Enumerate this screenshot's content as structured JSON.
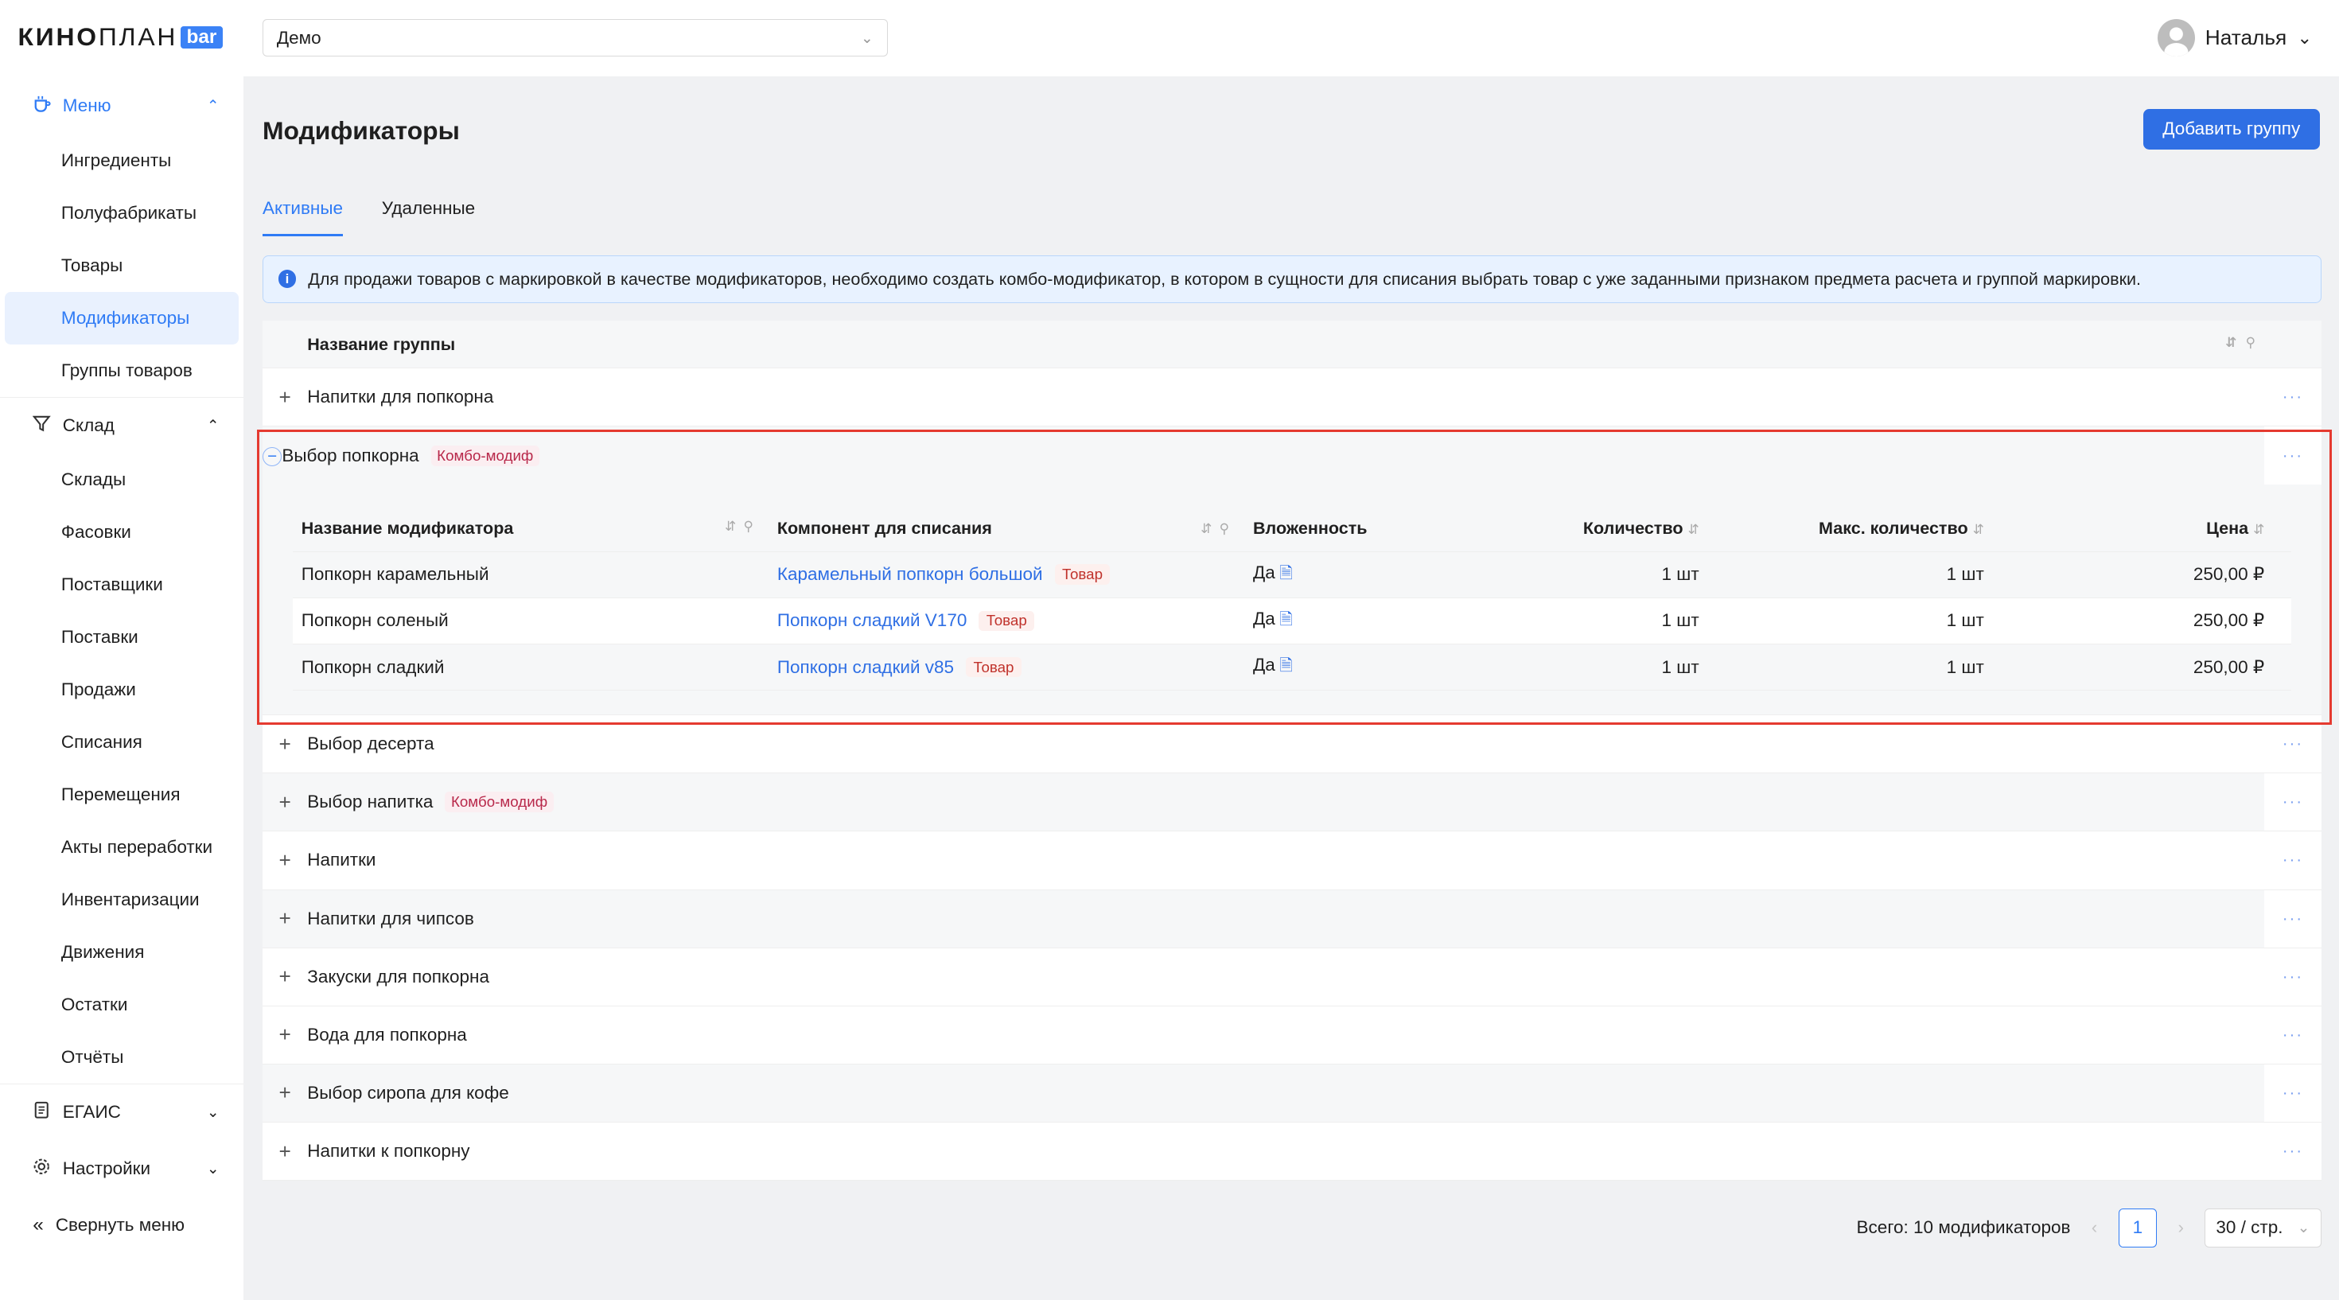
{
  "brand": {
    "part1": "КИНО",
    "part2": "ПЛАН",
    "badge": "bar"
  },
  "top": {
    "cinema_select": "Демо",
    "user_name": "Наталья"
  },
  "sidebar": {
    "menu_group": "Меню",
    "menu_items": [
      "Ингредиенты",
      "Полуфабрикаты",
      "Товары",
      "Модификаторы",
      "Группы товаров"
    ],
    "warehouse_group": "Склад",
    "warehouse_items": [
      "Склады",
      "Фасовки",
      "Поставщики",
      "Поставки",
      "Продажи",
      "Списания",
      "Перемещения",
      "Акты переработки",
      "Инвентаризации",
      "Движения",
      "Остатки",
      "Отчёты"
    ],
    "egais": "ЕГАИС",
    "settings": "Настройки",
    "collapse": "Свернуть меню"
  },
  "page": {
    "title": "Модификаторы",
    "add_button": "Добавить группу",
    "tabs": [
      "Активные",
      "Удаленные"
    ],
    "info": "Для продажи товаров с маркировкой в качестве модификаторов, необходимо создать комбо-модификатор, в котором в сущности для списания выбрать товар с уже заданными признаком предмета расчета и группой маркировки."
  },
  "table": {
    "header": "Название группы",
    "combo_badge": "Комбо-модиф",
    "more": "···",
    "groups_before": [
      {
        "name": "Напитки для попкорна",
        "combo": false
      }
    ],
    "expanded_group": {
      "name": "Выбор попкорна",
      "combo": true
    },
    "groups_after": [
      {
        "name": "Выбор десерта",
        "combo": false
      },
      {
        "name": "Выбор напитка",
        "combo": true
      },
      {
        "name": "Напитки",
        "combo": false
      },
      {
        "name": "Напитки для чипсов",
        "combo": false
      },
      {
        "name": "Закуски для попкорна",
        "combo": false
      },
      {
        "name": "Вода для попкорна",
        "combo": false
      },
      {
        "name": "Выбор сиропа для кофе",
        "combo": false
      },
      {
        "name": "Напитки к попкорну",
        "combo": false
      }
    ]
  },
  "inner": {
    "columns": [
      "Название модификатора",
      "Компонент для списания",
      "Вложенность",
      "Количество",
      "Макс. количество",
      "Цена"
    ],
    "tovar_badge": "Товар",
    "rows": [
      {
        "name": "Попкорн карамельный",
        "component": "Карамельный попкорн большой",
        "nested": "Да",
        "qty": "1 шт",
        "max": "1 шт",
        "price": "250,00 ₽"
      },
      {
        "name": "Попкорн соленый",
        "component": "Попкорн сладкий V170",
        "nested": "Да",
        "qty": "1 шт",
        "max": "1 шт",
        "price": "250,00 ₽"
      },
      {
        "name": "Попкорн сладкий",
        "component": "Попкорн сладкий v85",
        "nested": "Да",
        "qty": "1 шт",
        "max": "1 шт",
        "price": "250,00 ₽"
      }
    ]
  },
  "pager": {
    "total": "Всего: 10 модификаторов",
    "page": "1",
    "per_page": "30 / стр."
  },
  "colors": {
    "accent": "#2f6fe4",
    "highlight": "#e53a30"
  }
}
